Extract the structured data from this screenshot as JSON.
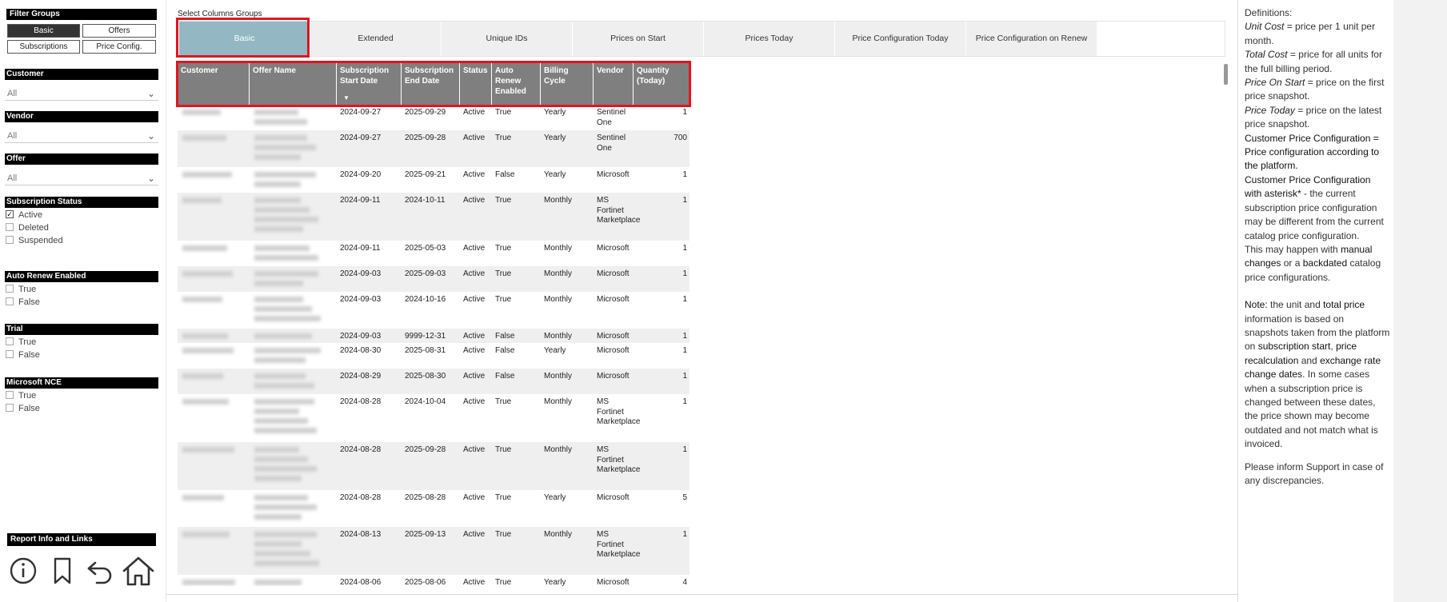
{
  "filters": {
    "filter_groups_title": "Filter Groups",
    "buttons": [
      {
        "label": "Basic",
        "active": true
      },
      {
        "label": "Offers",
        "active": false
      },
      {
        "label": "Subscriptions",
        "active": false
      },
      {
        "label": "Price Config.",
        "active": false
      }
    ],
    "customer": {
      "label": "Customer",
      "value": "All"
    },
    "vendor": {
      "label": "Vendor",
      "value": "All"
    },
    "offer": {
      "label": "Offer",
      "value": "All"
    },
    "subscription_status": {
      "label": "Subscription Status",
      "options": [
        "Active",
        "Deleted",
        "Suspended"
      ],
      "checked": [
        "Active"
      ]
    },
    "auto_renew": {
      "label": "Auto Renew Enabled",
      "options": [
        "True",
        "False"
      ]
    },
    "trial": {
      "label": "Trial",
      "options": [
        "True",
        "False"
      ]
    },
    "microsoft_nce": {
      "label": "Microsoft NCE",
      "options": [
        "True",
        "False"
      ]
    },
    "report_info_title": "Report Info and Links",
    "icons": [
      "info-icon",
      "bookmark-icon",
      "back-arrow-icon",
      "home-icon"
    ]
  },
  "select_columns_label": "Select Columns Groups",
  "tabs": [
    {
      "label": "Basic",
      "active": true
    },
    {
      "label": "Extended"
    },
    {
      "label": "Unique IDs"
    },
    {
      "label": "Prices on Start"
    },
    {
      "label": "Prices Today"
    },
    {
      "label": "Price Configuration Today"
    },
    {
      "label": "Price Configuration on Renew"
    }
  ],
  "table": {
    "headers": [
      "Customer",
      "Offer Name",
      "Subscription Start Date",
      "Subscription End Date",
      "Status",
      "Auto Renew Enabled",
      "Billing Cycle",
      "Vendor",
      "Quantity (Today)"
    ],
    "rows": [
      {
        "start": "2024-09-27",
        "end": "2025-09-29",
        "status": "Active",
        "auto": "True",
        "billing": "Yearly",
        "vendor": "Sentinel One",
        "qty": "1"
      },
      {
        "start": "2024-09-27",
        "end": "2025-09-28",
        "status": "Active",
        "auto": "True",
        "billing": "Yearly",
        "vendor": "Sentinel One",
        "qty": "700"
      },
      {
        "start": "2024-09-20",
        "end": "2025-09-21",
        "status": "Active",
        "auto": "False",
        "billing": "Yearly",
        "vendor": "Microsoft",
        "qty": "1"
      },
      {
        "start": "2024-09-11",
        "end": "2024-10-11",
        "status": "Active",
        "auto": "True",
        "billing": "Monthly",
        "vendor": "MS Fortinet Marketplace",
        "qty": "1"
      },
      {
        "start": "2024-09-11",
        "end": "2025-05-03",
        "status": "Active",
        "auto": "True",
        "billing": "Monthly",
        "vendor": "Microsoft",
        "qty": "1"
      },
      {
        "start": "2024-09-03",
        "end": "2025-09-03",
        "status": "Active",
        "auto": "True",
        "billing": "Monthly",
        "vendor": "Microsoft",
        "qty": "1"
      },
      {
        "start": "2024-09-03",
        "end": "2024-10-16",
        "status": "Active",
        "auto": "True",
        "billing": "Monthly",
        "vendor": "Microsoft",
        "qty": "1"
      },
      {
        "start": "2024-09-03",
        "end": "9999-12-31",
        "status": "Active",
        "auto": "False",
        "billing": "Monthly",
        "vendor": "Microsoft",
        "qty": "1"
      },
      {
        "start": "2024-08-30",
        "end": "2025-08-31",
        "status": "Active",
        "auto": "False",
        "billing": "Yearly",
        "vendor": "Microsoft",
        "qty": "1"
      },
      {
        "start": "2024-08-29",
        "end": "2025-08-30",
        "status": "Active",
        "auto": "False",
        "billing": "Monthly",
        "vendor": "Microsoft",
        "qty": "1"
      },
      {
        "start": "2024-08-28",
        "end": "2024-10-04",
        "status": "Active",
        "auto": "True",
        "billing": "Monthly",
        "vendor": "MS Fortinet Marketplace",
        "qty": "1"
      },
      {
        "start": "2024-08-28",
        "end": "2025-09-28",
        "status": "Active",
        "auto": "True",
        "billing": "Monthly",
        "vendor": "MS Fortinet Marketplace",
        "qty": "1"
      },
      {
        "start": "2024-08-28",
        "end": "2025-08-28",
        "status": "Active",
        "auto": "True",
        "billing": "Yearly",
        "vendor": "Microsoft",
        "qty": "5"
      },
      {
        "start": "2024-08-13",
        "end": "2025-09-13",
        "status": "Active",
        "auto": "True",
        "billing": "Monthly",
        "vendor": "MS Fortinet Marketplace",
        "qty": "1"
      },
      {
        "start": "2024-08-06",
        "end": "2025-08-06",
        "status": "Active",
        "auto": "True",
        "billing": "Yearly",
        "vendor": "Microsoft",
        "qty": "4"
      }
    ]
  },
  "definitions": {
    "title": "Definitions:",
    "unit_cost_term": "Unit Cost",
    "unit_cost_text": " = price per 1 unit per month.",
    "total_cost_term": "Total Cost",
    "total_cost_text": " = price for all units for the full billing period.",
    "price_on_start_term": "Price On Start",
    "price_on_start_text": " = price on the first price snapshot.",
    "price_today_term": "Price Today",
    "price_today_text": " = price on the latest price snapshot.",
    "cpc_text": "Customer Price Configuration = Price configuration according to the platform.",
    "cpc_asterisk_term": "Customer Price Configuration with asterisk*",
    "cpc_asterisk_text": " - the current subscription price configuration may be different from the current catalog price configuration.",
    "may_happen_prefix": "This may happen with ",
    "manual_changes": "manual changes",
    "may_happen_mid": " or a ",
    "backdated": "backdated",
    "may_happen_suffix": " catalog price configurations.",
    "note_prefix": "Note:",
    "note_a": " the unit and ",
    "note_total": "total price",
    "note_b": " information is based on snapshots taken from the platform on ",
    "note_sub_start": "subscription start",
    "note_c": ", ",
    "note_recalc": "price recalculation",
    "note_d": " and ",
    "note_exchange": "exchange rate change dates",
    "note_e": ". In some cases when a subscription price is changed between these dates, the price shown may become outdated and not match what is invoiced.",
    "support_text": "Please inform Support in case of any discrepancies."
  }
}
